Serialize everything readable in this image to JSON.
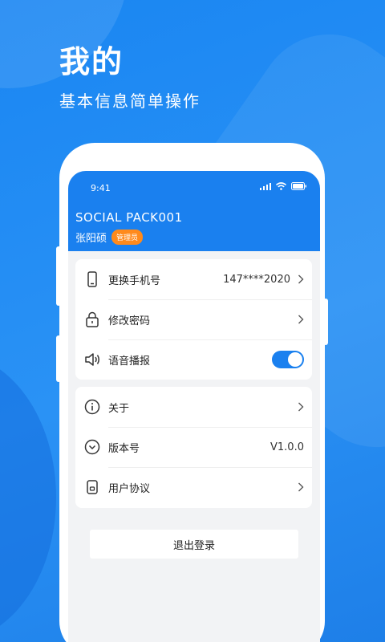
{
  "hero": {
    "title": "我的",
    "subtitle": "基本信息简单操作"
  },
  "status_bar": {
    "time": "9:41",
    "icons": [
      "signal-icon",
      "wifi-icon",
      "battery-icon"
    ]
  },
  "header": {
    "app_title": "SOCIAL PACK001",
    "user_name": "张阳硕",
    "role_badge": "管理员"
  },
  "settings_group_1": [
    {
      "icon": "phone-icon",
      "label": "更换手机号",
      "value": "147****2020",
      "has_chevron": true
    },
    {
      "icon": "lock-icon",
      "label": "修改密码",
      "value": "",
      "has_chevron": true
    },
    {
      "icon": "speaker-icon",
      "label": "语音播报",
      "toggle_on": true
    }
  ],
  "settings_group_2": [
    {
      "icon": "info-icon",
      "label": "关于",
      "value": "",
      "has_chevron": true
    },
    {
      "icon": "version-icon",
      "label": "版本号",
      "value": "V1.0.0",
      "has_chevron": false
    },
    {
      "icon": "agreement-icon",
      "label": "用户协议",
      "value": "",
      "has_chevron": true
    }
  ],
  "logout_label": "退出登录",
  "colors": {
    "primary": "#1a80ef",
    "badge": "#ff8a1c",
    "screen_bg": "#f2f3f5"
  }
}
